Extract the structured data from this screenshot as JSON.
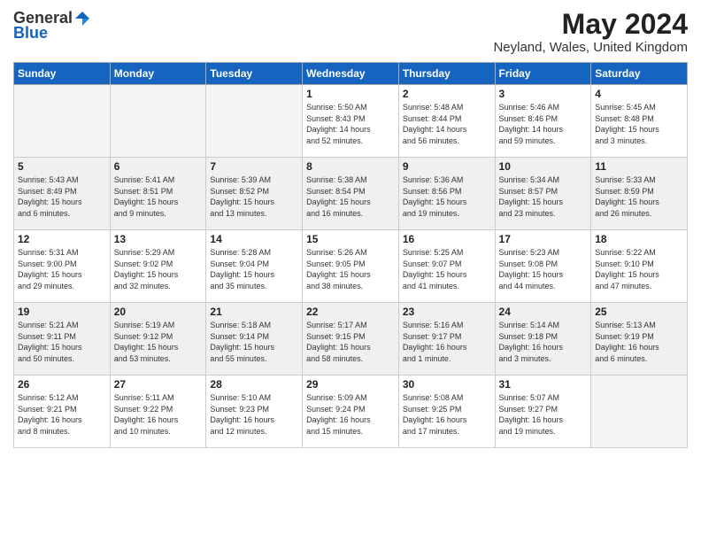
{
  "logo": {
    "general": "General",
    "blue": "Blue"
  },
  "header": {
    "month": "May 2024",
    "location": "Neyland, Wales, United Kingdom"
  },
  "weekdays": [
    "Sunday",
    "Monday",
    "Tuesday",
    "Wednesday",
    "Thursday",
    "Friday",
    "Saturday"
  ],
  "weeks": [
    [
      {
        "day": "",
        "info": ""
      },
      {
        "day": "",
        "info": ""
      },
      {
        "day": "",
        "info": ""
      },
      {
        "day": "1",
        "info": "Sunrise: 5:50 AM\nSunset: 8:43 PM\nDaylight: 14 hours\nand 52 minutes."
      },
      {
        "day": "2",
        "info": "Sunrise: 5:48 AM\nSunset: 8:44 PM\nDaylight: 14 hours\nand 56 minutes."
      },
      {
        "day": "3",
        "info": "Sunrise: 5:46 AM\nSunset: 8:46 PM\nDaylight: 14 hours\nand 59 minutes."
      },
      {
        "day": "4",
        "info": "Sunrise: 5:45 AM\nSunset: 8:48 PM\nDaylight: 15 hours\nand 3 minutes."
      }
    ],
    [
      {
        "day": "5",
        "info": "Sunrise: 5:43 AM\nSunset: 8:49 PM\nDaylight: 15 hours\nand 6 minutes."
      },
      {
        "day": "6",
        "info": "Sunrise: 5:41 AM\nSunset: 8:51 PM\nDaylight: 15 hours\nand 9 minutes."
      },
      {
        "day": "7",
        "info": "Sunrise: 5:39 AM\nSunset: 8:52 PM\nDaylight: 15 hours\nand 13 minutes."
      },
      {
        "day": "8",
        "info": "Sunrise: 5:38 AM\nSunset: 8:54 PM\nDaylight: 15 hours\nand 16 minutes."
      },
      {
        "day": "9",
        "info": "Sunrise: 5:36 AM\nSunset: 8:56 PM\nDaylight: 15 hours\nand 19 minutes."
      },
      {
        "day": "10",
        "info": "Sunrise: 5:34 AM\nSunset: 8:57 PM\nDaylight: 15 hours\nand 23 minutes."
      },
      {
        "day": "11",
        "info": "Sunrise: 5:33 AM\nSunset: 8:59 PM\nDaylight: 15 hours\nand 26 minutes."
      }
    ],
    [
      {
        "day": "12",
        "info": "Sunrise: 5:31 AM\nSunset: 9:00 PM\nDaylight: 15 hours\nand 29 minutes."
      },
      {
        "day": "13",
        "info": "Sunrise: 5:29 AM\nSunset: 9:02 PM\nDaylight: 15 hours\nand 32 minutes."
      },
      {
        "day": "14",
        "info": "Sunrise: 5:28 AM\nSunset: 9:04 PM\nDaylight: 15 hours\nand 35 minutes."
      },
      {
        "day": "15",
        "info": "Sunrise: 5:26 AM\nSunset: 9:05 PM\nDaylight: 15 hours\nand 38 minutes."
      },
      {
        "day": "16",
        "info": "Sunrise: 5:25 AM\nSunset: 9:07 PM\nDaylight: 15 hours\nand 41 minutes."
      },
      {
        "day": "17",
        "info": "Sunrise: 5:23 AM\nSunset: 9:08 PM\nDaylight: 15 hours\nand 44 minutes."
      },
      {
        "day": "18",
        "info": "Sunrise: 5:22 AM\nSunset: 9:10 PM\nDaylight: 15 hours\nand 47 minutes."
      }
    ],
    [
      {
        "day": "19",
        "info": "Sunrise: 5:21 AM\nSunset: 9:11 PM\nDaylight: 15 hours\nand 50 minutes."
      },
      {
        "day": "20",
        "info": "Sunrise: 5:19 AM\nSunset: 9:12 PM\nDaylight: 15 hours\nand 53 minutes."
      },
      {
        "day": "21",
        "info": "Sunrise: 5:18 AM\nSunset: 9:14 PM\nDaylight: 15 hours\nand 55 minutes."
      },
      {
        "day": "22",
        "info": "Sunrise: 5:17 AM\nSunset: 9:15 PM\nDaylight: 15 hours\nand 58 minutes."
      },
      {
        "day": "23",
        "info": "Sunrise: 5:16 AM\nSunset: 9:17 PM\nDaylight: 16 hours\nand 1 minute."
      },
      {
        "day": "24",
        "info": "Sunrise: 5:14 AM\nSunset: 9:18 PM\nDaylight: 16 hours\nand 3 minutes."
      },
      {
        "day": "25",
        "info": "Sunrise: 5:13 AM\nSunset: 9:19 PM\nDaylight: 16 hours\nand 6 minutes."
      }
    ],
    [
      {
        "day": "26",
        "info": "Sunrise: 5:12 AM\nSunset: 9:21 PM\nDaylight: 16 hours\nand 8 minutes."
      },
      {
        "day": "27",
        "info": "Sunrise: 5:11 AM\nSunset: 9:22 PM\nDaylight: 16 hours\nand 10 minutes."
      },
      {
        "day": "28",
        "info": "Sunrise: 5:10 AM\nSunset: 9:23 PM\nDaylight: 16 hours\nand 12 minutes."
      },
      {
        "day": "29",
        "info": "Sunrise: 5:09 AM\nSunset: 9:24 PM\nDaylight: 16 hours\nand 15 minutes."
      },
      {
        "day": "30",
        "info": "Sunrise: 5:08 AM\nSunset: 9:25 PM\nDaylight: 16 hours\nand 17 minutes."
      },
      {
        "day": "31",
        "info": "Sunrise: 5:07 AM\nSunset: 9:27 PM\nDaylight: 16 hours\nand 19 minutes."
      },
      {
        "day": "",
        "info": ""
      }
    ]
  ]
}
